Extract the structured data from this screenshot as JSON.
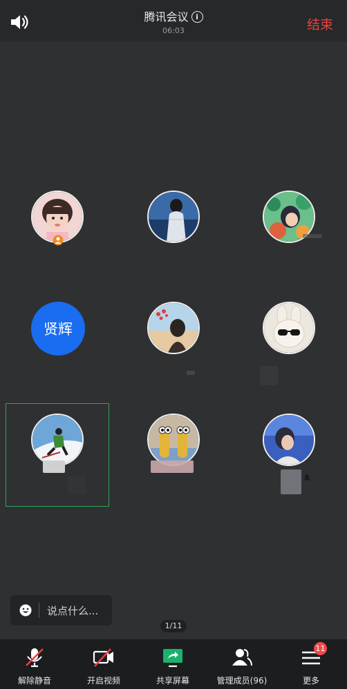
{
  "header": {
    "title": "腾讯会议",
    "info_icon": "info-icon",
    "timer": "06:03",
    "end_label": "结束",
    "end_color": "#e8433f"
  },
  "participants": [
    {
      "type": "photo",
      "icon": "avatar-girl"
    },
    {
      "type": "photo",
      "icon": "avatar-person-back"
    },
    {
      "type": "photo",
      "icon": "avatar-illustration"
    },
    {
      "type": "text",
      "label": "贤辉",
      "color": "#1a6cf0"
    },
    {
      "type": "photo",
      "icon": "avatar-beach-girl"
    },
    {
      "type": "photo",
      "icon": "avatar-plush-bunny"
    },
    {
      "type": "photo",
      "icon": "avatar-skier",
      "speaking": true
    },
    {
      "type": "photo",
      "icon": "avatar-figures"
    },
    {
      "type": "photo",
      "icon": "avatar-boy"
    }
  ],
  "chat": {
    "placeholder": "说点什么...",
    "icon": "emoji-icon"
  },
  "pagination": {
    "label": "1/11"
  },
  "toolbar": {
    "items": [
      {
        "label": "解除静音",
        "icon": "microphone-muted-icon"
      },
      {
        "label": "开启视频",
        "icon": "video-off-icon"
      },
      {
        "label": "共享屏幕",
        "icon": "share-screen-icon"
      },
      {
        "label": "管理成员(96)",
        "icon": "members-icon"
      },
      {
        "label": "更多",
        "icon": "menu-icon",
        "badge": "11"
      }
    ]
  }
}
